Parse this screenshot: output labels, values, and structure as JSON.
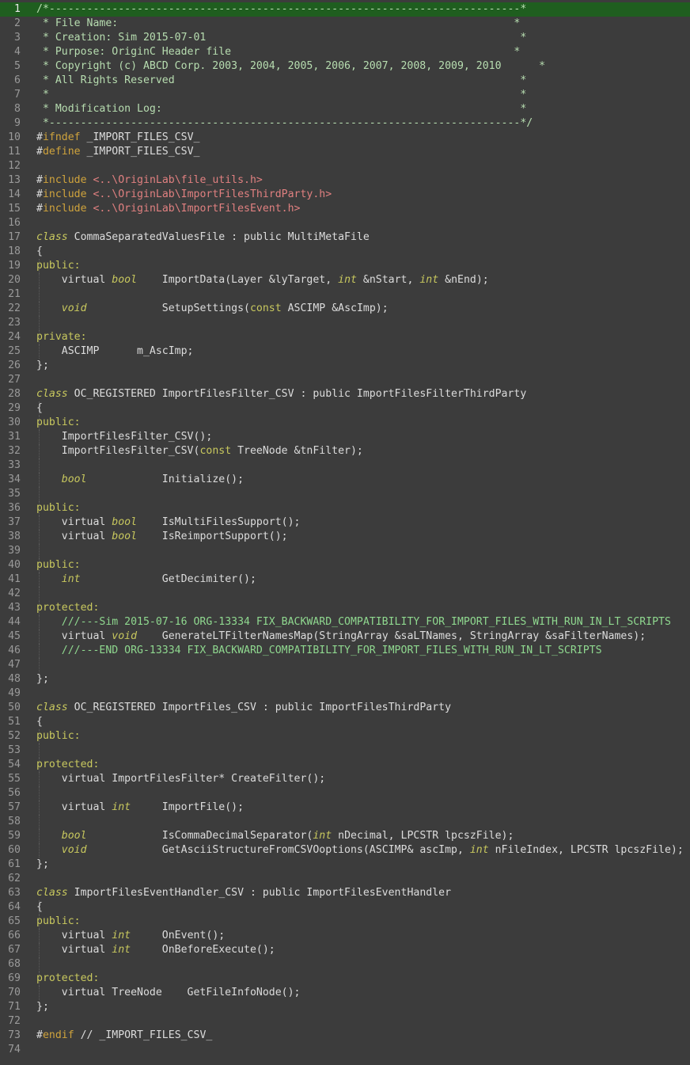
{
  "editor": {
    "language": "OriginC / C++",
    "current_line": 1,
    "lines": [
      [
        [
          "cm",
          "/*---------------------------------------------------------------------------*"
        ]
      ],
      [
        [
          "cm",
          " * File Name:                                                               *"
        ]
      ],
      [
        [
          "cm",
          " * Creation: Sim 2015-07-01                                                  *"
        ]
      ],
      [
        [
          "cm",
          " * Purpose: OriginC Header file                                             *"
        ]
      ],
      [
        [
          "cm",
          " * Copyright (c) ABCD Corp. 2003, 2004, 2005, 2006, 2007, 2008, 2009, 2010      *"
        ]
      ],
      [
        [
          "cm",
          " * All Rights Reserved                                                       *"
        ]
      ],
      [
        [
          "cm",
          " *                                                                           *"
        ]
      ],
      [
        [
          "cm",
          " * Modification Log:                                                         *"
        ]
      ],
      [
        [
          "cm",
          " *---------------------------------------------------------------------------*/"
        ]
      ],
      [
        [
          "t",
          "#"
        ],
        [
          "pp",
          "ifndef"
        ],
        [
          "t",
          " _IMPORT_FILES_CSV_"
        ]
      ],
      [
        [
          "t",
          "#"
        ],
        [
          "pp",
          "define"
        ],
        [
          "t",
          " _IMPORT_FILES_CSV_"
        ]
      ],
      [],
      [
        [
          "t",
          "#"
        ],
        [
          "pp",
          "include"
        ],
        [
          "t",
          " "
        ],
        [
          "inc",
          "<..\\OriginLab\\file_utils.h>"
        ]
      ],
      [
        [
          "t",
          "#"
        ],
        [
          "pp",
          "include"
        ],
        [
          "t",
          " "
        ],
        [
          "inc",
          "<..\\OriginLab\\ImportFilesThirdParty.h>"
        ]
      ],
      [
        [
          "t",
          "#"
        ],
        [
          "pp",
          "include"
        ],
        [
          "t",
          " "
        ],
        [
          "inc",
          "<..\\OriginLab\\ImportFilesEvent.h>"
        ]
      ],
      [],
      [
        [
          "kw",
          "class"
        ],
        [
          "t",
          " CommaSeparatedValuesFile : public MultiMetaFile"
        ]
      ],
      [
        [
          "t",
          "{"
        ]
      ],
      [
        [
          "acc",
          "public:"
        ]
      ],
      [
        [
          "t",
          "    virtual "
        ],
        [
          "kw",
          "bool"
        ],
        [
          "t",
          "    ImportData(Layer &lyTarget, "
        ],
        [
          "kw",
          "int"
        ],
        [
          "t",
          " &nStart, "
        ],
        [
          "kw",
          "int"
        ],
        [
          "t",
          " &nEnd);"
        ]
      ],
      [],
      [
        [
          "t",
          "    "
        ],
        [
          "kw",
          "void"
        ],
        [
          "t",
          "            SetupSettings("
        ],
        [
          "acc",
          "const"
        ],
        [
          "t",
          " ASCIMP &AscImp);"
        ]
      ],
      [],
      [
        [
          "acc",
          "private:"
        ]
      ],
      [
        [
          "t",
          "    ASCIMP      m_AscImp;"
        ]
      ],
      [
        [
          "t",
          "};"
        ]
      ],
      [],
      [
        [
          "kw",
          "class"
        ],
        [
          "t",
          " OC_REGISTERED ImportFilesFilter_CSV : public ImportFilesFilterThirdParty"
        ]
      ],
      [
        [
          "t",
          "{"
        ]
      ],
      [
        [
          "acc",
          "public:"
        ]
      ],
      [
        [
          "t",
          "    ImportFilesFilter_CSV();"
        ]
      ],
      [
        [
          "t",
          "    ImportFilesFilter_CSV("
        ],
        [
          "acc",
          "const"
        ],
        [
          "t",
          " TreeNode &tnFilter);"
        ]
      ],
      [],
      [
        [
          "t",
          "    "
        ],
        [
          "kw",
          "bool"
        ],
        [
          "t",
          "            Initialize();"
        ]
      ],
      [],
      [
        [
          "acc",
          "public:"
        ]
      ],
      [
        [
          "t",
          "    virtual "
        ],
        [
          "kw",
          "bool"
        ],
        [
          "t",
          "    IsMultiFilesSupport();"
        ]
      ],
      [
        [
          "t",
          "    virtual "
        ],
        [
          "kw",
          "bool"
        ],
        [
          "t",
          "    IsReimportSupport();"
        ]
      ],
      [],
      [
        [
          "acc",
          "public:"
        ]
      ],
      [
        [
          "t",
          "    "
        ],
        [
          "kw",
          "int"
        ],
        [
          "t",
          "             GetDecimiter();"
        ]
      ],
      [],
      [
        [
          "acc",
          "protected:"
        ]
      ],
      [
        [
          "t",
          "    "
        ],
        [
          "cm2",
          "///---Sim 2015-07-16 ORG-13334 FIX_BACKWARD_COMPATIBILITY_FOR_IMPORT_FILES_WITH_RUN_IN_LT_SCRIPTS"
        ]
      ],
      [
        [
          "t",
          "    virtual "
        ],
        [
          "kw",
          "void"
        ],
        [
          "t",
          "    GenerateLTFilterNamesMap(StringArray &saLTNames, StringArray &saFilterNames);"
        ]
      ],
      [
        [
          "t",
          "    "
        ],
        [
          "cm2",
          "///---END ORG-13334 FIX_BACKWARD_COMPATIBILITY_FOR_IMPORT_FILES_WITH_RUN_IN_LT_SCRIPTS"
        ]
      ],
      [],
      [
        [
          "t",
          "};"
        ]
      ],
      [],
      [
        [
          "kw",
          "class"
        ],
        [
          "t",
          " OC_REGISTERED ImportFiles_CSV : public ImportFilesThirdParty"
        ]
      ],
      [
        [
          "t",
          "{"
        ]
      ],
      [
        [
          "acc",
          "public:"
        ]
      ],
      [],
      [
        [
          "acc",
          "protected:"
        ]
      ],
      [
        [
          "t",
          "    virtual ImportFilesFilter* CreateFilter();"
        ]
      ],
      [],
      [
        [
          "t",
          "    virtual "
        ],
        [
          "kw",
          "int"
        ],
        [
          "t",
          "     ImportFile();"
        ]
      ],
      [],
      [
        [
          "t",
          "    "
        ],
        [
          "kw",
          "bool"
        ],
        [
          "t",
          "            IsCommaDecimalSeparator("
        ],
        [
          "kw",
          "int"
        ],
        [
          "t",
          " nDecimal, LPCSTR lpcszFile);"
        ]
      ],
      [
        [
          "t",
          "    "
        ],
        [
          "kw",
          "void"
        ],
        [
          "t",
          "            GetAsciiStructureFromCSVOoptions(ASCIMP& ascImp, "
        ],
        [
          "kw",
          "int"
        ],
        [
          "t",
          " nFileIndex, LPCSTR lpcszFile);"
        ]
      ],
      [
        [
          "t",
          "};"
        ]
      ],
      [],
      [
        [
          "kw",
          "class"
        ],
        [
          "t",
          " ImportFilesEventHandler_CSV : public ImportFilesEventHandler"
        ]
      ],
      [
        [
          "t",
          "{"
        ]
      ],
      [
        [
          "acc",
          "public:"
        ]
      ],
      [
        [
          "t",
          "    virtual "
        ],
        [
          "kw",
          "int"
        ],
        [
          "t",
          "     OnEvent();"
        ]
      ],
      [
        [
          "t",
          "    virtual "
        ],
        [
          "kw",
          "int"
        ],
        [
          "t",
          "     OnBeforeExecute();"
        ]
      ],
      [],
      [
        [
          "acc",
          "protected:"
        ]
      ],
      [
        [
          "t",
          "    virtual TreeNode    GetFileInfoNode();"
        ]
      ],
      [
        [
          "t",
          "};"
        ]
      ],
      [],
      [
        [
          "t",
          "#"
        ],
        [
          "pp",
          "endif"
        ],
        [
          "t",
          " // _IMPORT_FILES_CSV_"
        ]
      ],
      []
    ]
  }
}
